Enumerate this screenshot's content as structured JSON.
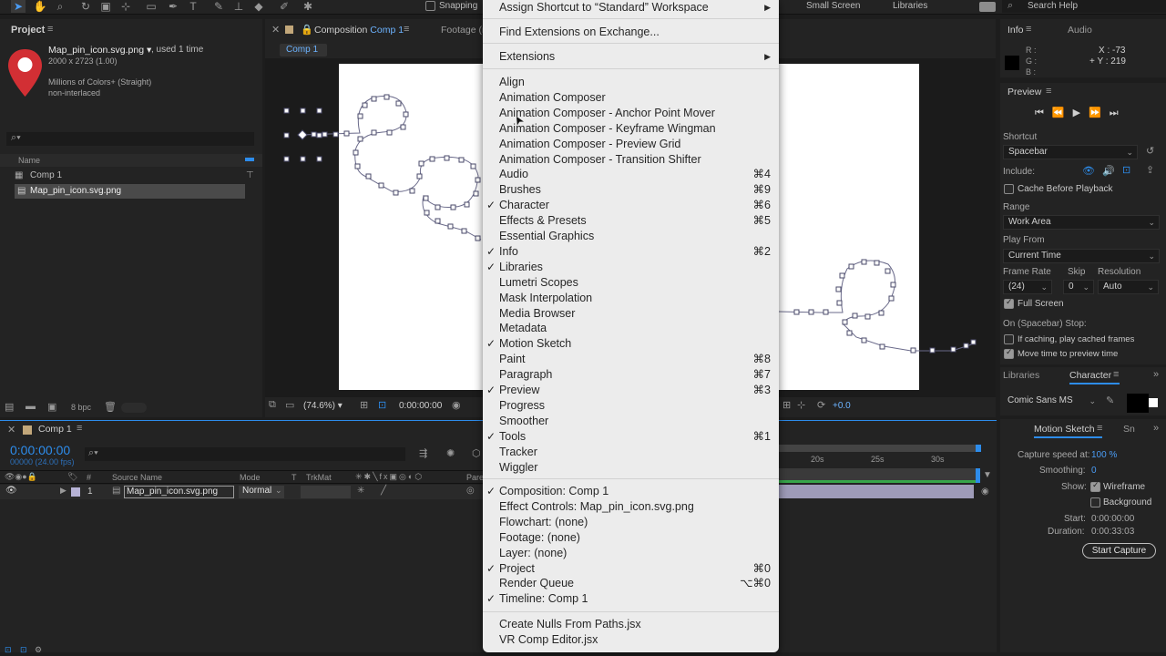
{
  "toolbar": {
    "snapping_label": "Snapping",
    "workspace_small_screen": "Small Screen",
    "workspace_libraries": "Libraries",
    "search_help_placeholder": "Search Help"
  },
  "project_panel": {
    "tab_label": "Project",
    "footage_name": "Map_pin_icon.svg.png",
    "footage_usage": ", used 1 time",
    "footage_dimensions": "2000 x 2723 (1.00)",
    "footage_colors": "Millions of Colors+ (Straight)",
    "footage_interlace": "non-interlaced",
    "search_placeholder": "",
    "column_name": "Name",
    "items": [
      {
        "label": "Comp 1",
        "icon": "composition-icon"
      },
      {
        "label": "Map_pin_icon.svg.png",
        "icon": "footage-icon"
      }
    ],
    "bpc_label": "8 bpc"
  },
  "composition_panel": {
    "tab_prefix": "Composition",
    "tab_comp_name": "Comp 1",
    "footage_tab": "Footage (n",
    "breadcrumb": "Comp 1",
    "zoom_label": "(74.6%)",
    "timecode": "0:00:00:00",
    "exposure": "+0.0"
  },
  "menu": {
    "top_items": [
      {
        "label": "Assign Shortcut to “Standard” Workspace",
        "submenu": true
      },
      {
        "label": "Find Extensions on Exchange...",
        "submenu": false
      },
      {
        "label": "Extensions",
        "submenu": true
      }
    ],
    "panel_items": [
      {
        "label": "Align",
        "checked": false,
        "shortcut": ""
      },
      {
        "label": "Animation Composer",
        "checked": false,
        "shortcut": ""
      },
      {
        "label": "Animation Composer - Anchor Point Mover",
        "checked": false,
        "shortcut": ""
      },
      {
        "label": "Animation Composer - Keyframe Wingman",
        "checked": false,
        "shortcut": ""
      },
      {
        "label": "Animation Composer - Preview Grid",
        "checked": false,
        "shortcut": ""
      },
      {
        "label": "Animation Composer - Transition Shifter",
        "checked": false,
        "shortcut": ""
      },
      {
        "label": "Audio",
        "checked": false,
        "shortcut": "⌘4"
      },
      {
        "label": "Brushes",
        "checked": false,
        "shortcut": "⌘9"
      },
      {
        "label": "Character",
        "checked": true,
        "shortcut": "⌘6"
      },
      {
        "label": "Effects & Presets",
        "checked": false,
        "shortcut": "⌘5"
      },
      {
        "label": "Essential Graphics",
        "checked": false,
        "shortcut": ""
      },
      {
        "label": "Info",
        "checked": true,
        "shortcut": "⌘2"
      },
      {
        "label": "Libraries",
        "checked": true,
        "shortcut": ""
      },
      {
        "label": "Lumetri Scopes",
        "checked": false,
        "shortcut": ""
      },
      {
        "label": "Mask Interpolation",
        "checked": false,
        "shortcut": ""
      },
      {
        "label": "Media Browser",
        "checked": false,
        "shortcut": ""
      },
      {
        "label": "Metadata",
        "checked": false,
        "shortcut": ""
      },
      {
        "label": "Motion Sketch",
        "checked": true,
        "shortcut": ""
      },
      {
        "label": "Paint",
        "checked": false,
        "shortcut": "⌘8"
      },
      {
        "label": "Paragraph",
        "checked": false,
        "shortcut": "⌘7"
      },
      {
        "label": "Preview",
        "checked": true,
        "shortcut": "⌘3"
      },
      {
        "label": "Progress",
        "checked": false,
        "shortcut": ""
      },
      {
        "label": "Smoother",
        "checked": false,
        "shortcut": ""
      },
      {
        "label": "Tools",
        "checked": true,
        "shortcut": "⌘1"
      },
      {
        "label": "Tracker",
        "checked": false,
        "shortcut": ""
      },
      {
        "label": "Wiggler",
        "checked": false,
        "shortcut": ""
      }
    ],
    "viewer_items": [
      {
        "label": "Composition: Comp 1",
        "checked": true,
        "shortcut": ""
      },
      {
        "label": "Effect Controls: Map_pin_icon.svg.png",
        "checked": false,
        "shortcut": ""
      },
      {
        "label": "Flowchart: (none)",
        "checked": false,
        "shortcut": ""
      },
      {
        "label": "Footage: (none)",
        "checked": false,
        "shortcut": ""
      },
      {
        "label": "Layer: (none)",
        "checked": false,
        "shortcut": ""
      },
      {
        "label": "Project",
        "checked": true,
        "shortcut": "⌘0"
      },
      {
        "label": "Render Queue",
        "checked": false,
        "shortcut": "⌥⌘0"
      },
      {
        "label": "Timeline: Comp 1",
        "checked": true,
        "shortcut": ""
      }
    ],
    "script_items": [
      {
        "label": "Create Nulls From Paths.jsx"
      },
      {
        "label": "VR Comp Editor.jsx"
      }
    ]
  },
  "info_panel": {
    "tab_info": "Info",
    "tab_audio": "Audio",
    "r_label": "R :",
    "g_label": "G :",
    "b_label": "B :",
    "x_readout": "X : -73",
    "y_readout": "+ Y : 219"
  },
  "preview_panel": {
    "tab_label": "Preview",
    "shortcut_label": "Shortcut",
    "shortcut_value": "Spacebar",
    "include_label": "Include:",
    "cache_before_playback": "Cache Before Playback",
    "range_label": "Range",
    "range_value": "Work Area",
    "play_from_label": "Play From",
    "play_from_value": "Current Time",
    "frame_rate_label": "Frame Rate",
    "skip_label": "Skip",
    "resolution_label": "Resolution",
    "frame_rate_value": "(24)",
    "skip_value": "0",
    "resolution_value": "Auto",
    "full_screen": "Full Screen",
    "on_stop_label": "On (Spacebar) Stop:",
    "if_caching": "If caching, play cached frames",
    "move_time": "Move time to preview time"
  },
  "character_panel": {
    "tab_libraries": "Libraries",
    "tab_character": "Character",
    "font_value": "Comic Sans MS"
  },
  "motion_sketch_panel": {
    "tab_label": "Motion Sketch",
    "tab_other": "Sn",
    "capture_speed_label": "Capture speed at:",
    "capture_speed_value": "100 %",
    "smoothing_label": "Smoothing:",
    "smoothing_value": "0",
    "show_label": "Show:",
    "wireframe": "Wireframe",
    "background": "Background",
    "start_label": "Start:",
    "start_value": "0:00:00:00",
    "duration_label": "Duration:",
    "duration_value": "0:00:33:03",
    "start_capture_button": "Start Capture"
  },
  "timeline": {
    "tab_label": "Comp 1",
    "timecode": "0:00:00:00",
    "frame_info": "00000 (24.00 fps)",
    "col_hash": "#",
    "col_source": "Source Name",
    "col_mode": "Mode",
    "col_t": "T",
    "col_trkmat": "TrkMat",
    "col_parent": "Pare",
    "layer_index": "1",
    "layer_name": "Map_pin_icon.svg.png",
    "layer_mode": "Normal",
    "ruler": [
      "20s",
      "25s",
      "30s"
    ]
  },
  "colors": {
    "accent_blue": "#2d8ceb",
    "menu_bg": "#ececec",
    "layer_purple": "#b7b3d6",
    "pin_red": "#d22f34"
  }
}
